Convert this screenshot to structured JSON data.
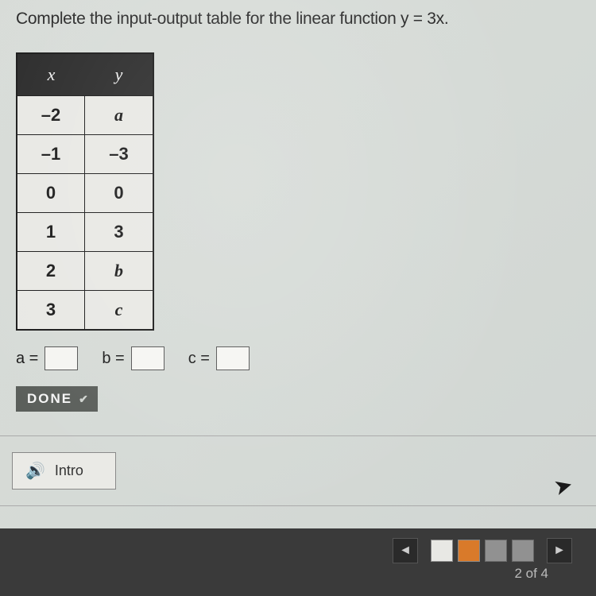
{
  "instruction": "Complete the input-output table for the linear function y = 3x.",
  "table": {
    "headers": {
      "x": "x",
      "y": "y"
    },
    "rows": [
      {
        "x": "–2",
        "y": "a",
        "y_italic": true
      },
      {
        "x": "–1",
        "y": "–3",
        "y_italic": false
      },
      {
        "x": "0",
        "y": "0",
        "y_italic": false
      },
      {
        "x": "1",
        "y": "3",
        "y_italic": false
      },
      {
        "x": "2",
        "y": "b",
        "y_italic": true
      },
      {
        "x": "3",
        "y": "c",
        "y_italic": true
      }
    ]
  },
  "answers": {
    "a_label": "a =",
    "a_value": "",
    "b_label": "b =",
    "b_value": "",
    "c_label": "c =",
    "c_value": ""
  },
  "done_label": "DONE",
  "intro_label": "Intro",
  "page_indicator": "2 of 4",
  "nav": {
    "prev": "◄",
    "next": "►"
  }
}
